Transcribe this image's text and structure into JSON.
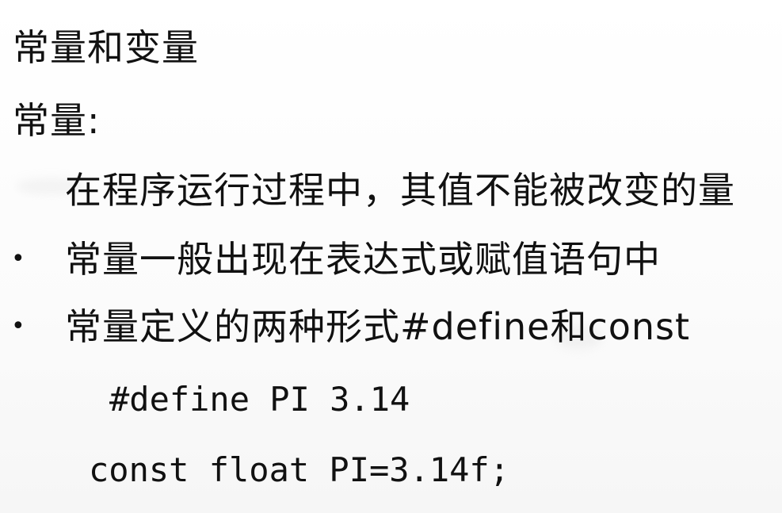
{
  "slide": {
    "title": "常量和变量",
    "heading": "常量:",
    "definition": "在程序运行过程中，其值不能被改变的量",
    "bullets": [
      {
        "marker": "•",
        "text": "常量一般出现在表达式或赋值语句中"
      },
      {
        "marker": "•",
        "text": "常量定义的两种形式#define和const"
      }
    ],
    "code_examples": [
      "#define PI 3.14",
      "const float PI=3.14f;"
    ]
  }
}
